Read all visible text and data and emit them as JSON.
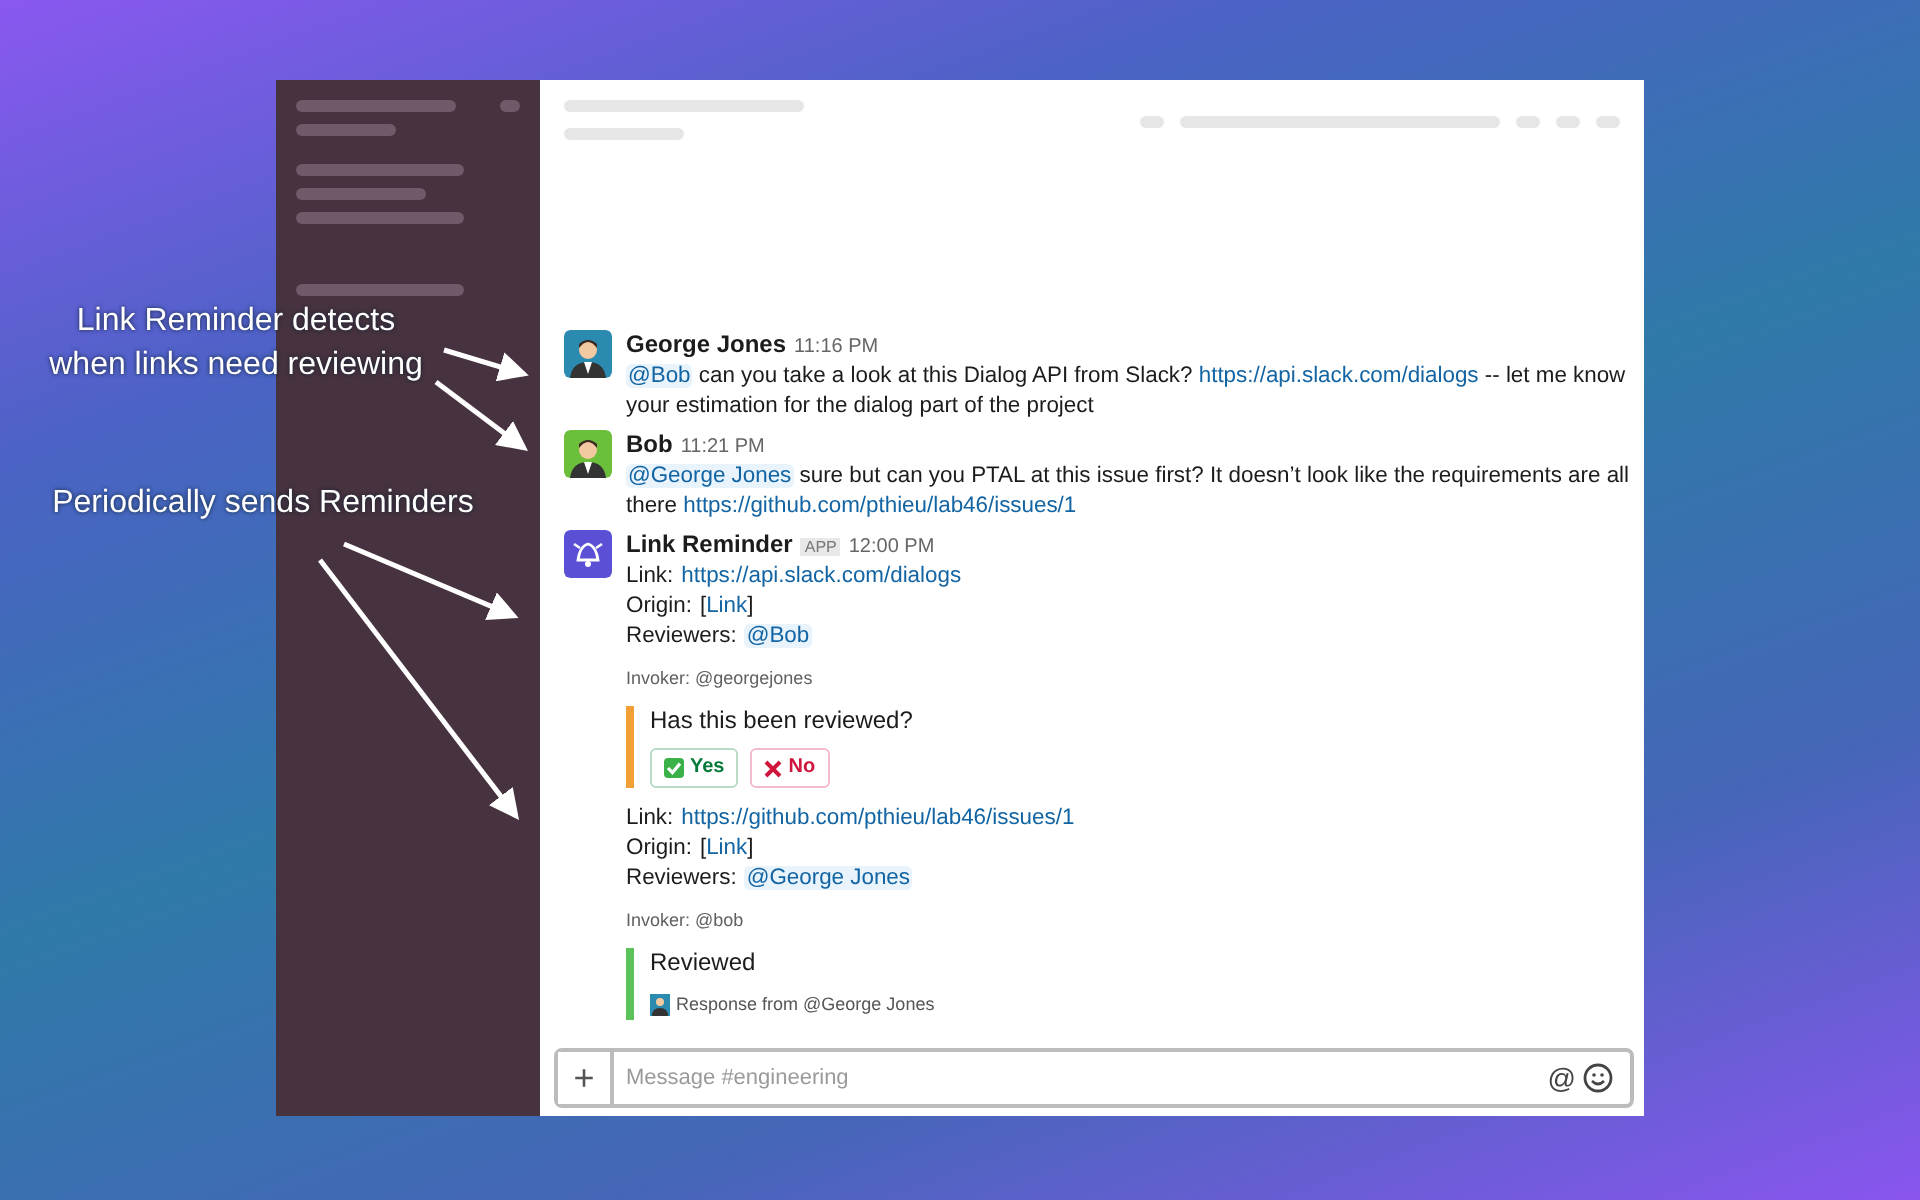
{
  "annotations": [
    {
      "text": "Link Reminder detects when links need reviewing"
    },
    {
      "text": "Periodically sends Reminders"
    }
  ],
  "messages": [
    {
      "kind": "user",
      "author": "George Jones",
      "time": "11:16 PM",
      "parts": [
        {
          "kind": "mention",
          "text": "@Bob"
        },
        {
          "kind": "text",
          "text": " can you take a look at this Dialog API from Slack? "
        },
        {
          "kind": "link",
          "text": "https://api.slack.com/dialogs"
        },
        {
          "kind": "text",
          "text": " -- let me know your estimation for the dialog part of the project"
        }
      ]
    },
    {
      "kind": "user",
      "author": "Bob",
      "time": "11:21 PM",
      "parts": [
        {
          "kind": "mention",
          "text": "@George Jones"
        },
        {
          "kind": "text",
          "text": " sure but can you PTAL at this issue first? It doesn’t look like the requirements are all there "
        },
        {
          "kind": "link",
          "text": "https://github.com/pthieu/lab46/issues/1"
        }
      ]
    },
    {
      "kind": "bot",
      "author": "Link Reminder",
      "badge": "APP",
      "time": "12:00 PM",
      "reminders": [
        {
          "fields": [
            {
              "label": "Link:",
              "parts": [
                {
                  "kind": "link",
                  "text": "https://api.slack.com/dialogs"
                }
              ]
            },
            {
              "label": "Origin:",
              "parts": [
                {
                  "kind": "text",
                  "text": "["
                },
                {
                  "kind": "link",
                  "text": "Link"
                },
                {
                  "kind": "text",
                  "text": "]"
                }
              ]
            },
            {
              "label": "Reviewers:",
              "parts": [
                {
                  "kind": "mention",
                  "text": "@Bob"
                }
              ]
            }
          ],
          "invoker": "Invoker: @georgejones",
          "attachment": {
            "color": "#f2a035",
            "title": "Has this been reviewed?",
            "buttons": [
              {
                "kind": "yes",
                "label": "Yes"
              },
              {
                "kind": "no",
                "label": "No"
              }
            ]
          }
        },
        {
          "fields": [
            {
              "label": "Link:",
              "parts": [
                {
                  "kind": "link",
                  "text": "https://github.com/pthieu/lab46/issues/1"
                }
              ]
            },
            {
              "label": "Origin:",
              "parts": [
                {
                  "kind": "text",
                  "text": "["
                },
                {
                  "kind": "link",
                  "text": "Link"
                },
                {
                  "kind": "text",
                  "text": "]"
                }
              ]
            },
            {
              "label": "Reviewers:",
              "parts": [
                {
                  "kind": "mention",
                  "text": "@George Jones"
                }
              ]
            }
          ],
          "invoker": "Invoker: @bob",
          "attachment": {
            "color": "#5ac35a",
            "title": "Reviewed",
            "response": "Response from @George Jones"
          }
        }
      ]
    }
  ],
  "composer": {
    "placeholder": "Message #engineering",
    "plus": "+",
    "mention": "@"
  }
}
